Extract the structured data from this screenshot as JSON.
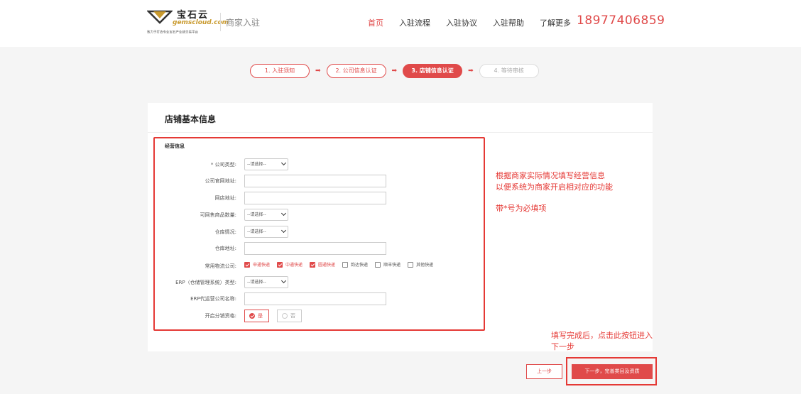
{
  "header": {
    "logo_cn": "宝石云",
    "logo_en": "gemscloud.com",
    "logo_slogan": "致力于打造专业宝石产业链交易平台",
    "subtitle": "商家入驻",
    "nav": [
      "首页",
      "入驻流程",
      "入驻协议",
      "入驻帮助",
      "了解更多"
    ],
    "nav_active_index": 0,
    "phone": "18977406859"
  },
  "steps": [
    {
      "label": "1. 入驻须知",
      "state": "done"
    },
    {
      "label": "2. 公司信息认证",
      "state": "done"
    },
    {
      "label": "3. 店铺信息认证",
      "state": "active"
    },
    {
      "label": "4. 等待审核",
      "state": "pending"
    }
  ],
  "panel": {
    "title": "店铺基本信息",
    "section": "经营信息"
  },
  "form": {
    "company_type_label": "* 公司类型:",
    "company_type_value": "--请选择--",
    "website_label": "公司官网地址:",
    "website_value": "",
    "shop_label": "网店地址:",
    "shop_value": "",
    "goods_count_label": "可网售商品数量:",
    "goods_count_value": "--请选择--",
    "warehouse_label": "仓库情况:",
    "warehouse_value": "--请选择--",
    "warehouse_addr_label": "仓库地址:",
    "warehouse_addr_value": "",
    "logistics_label": "常用物流公司:",
    "logistics_options": [
      {
        "label": "申通快递",
        "checked": true
      },
      {
        "label": "中通快递",
        "checked": true
      },
      {
        "label": "圆通快递",
        "checked": true
      },
      {
        "label": "韵达快递",
        "checked": false
      },
      {
        "label": "顺丰快递",
        "checked": false
      },
      {
        "label": "其他快递",
        "checked": false
      }
    ],
    "erp_type_label": "ERP（仓储管理系统）类型:",
    "erp_type_value": "--请选择--",
    "erp_company_label": "ERP代运营公司名称:",
    "erp_company_value": "",
    "distribution_label": "开启分销资格:",
    "distribution_yes": "是",
    "distribution_no": "否",
    "distribution_selected": "yes"
  },
  "notes": {
    "note1_line1": "根据商家实际情况填写经营信息",
    "note1_line2": "以便系统为商家开启相对应的功能",
    "note2": "带*号为必填项",
    "note3_line1": "填写完成后，点击此按钮进入",
    "note3_line2": "下一步"
  },
  "buttons": {
    "prev": "上一步",
    "next": "下一步，完善类目及资质"
  },
  "colors": {
    "accent": "#e04a4a",
    "annotation": "#e53935"
  }
}
